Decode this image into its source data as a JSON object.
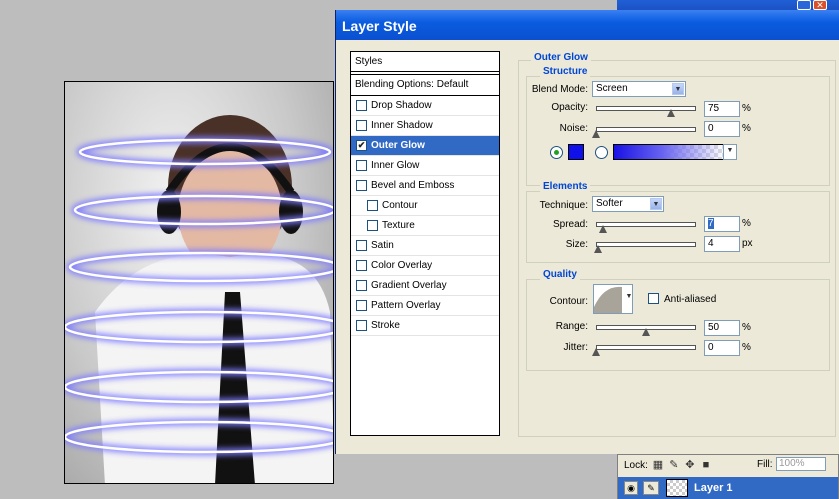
{
  "dialog": {
    "title": "Layer Style"
  },
  "styles_panel": {
    "header": "Styles",
    "blending_options": "Blending Options: Default",
    "items": [
      {
        "label": "Drop Shadow",
        "checked": false,
        "active": false,
        "indent": false
      },
      {
        "label": "Inner Shadow",
        "checked": false,
        "active": false,
        "indent": false
      },
      {
        "label": "Outer Glow",
        "checked": true,
        "active": true,
        "indent": false
      },
      {
        "label": "Inner Glow",
        "checked": false,
        "active": false,
        "indent": false
      },
      {
        "label": "Bevel and Emboss",
        "checked": false,
        "active": false,
        "indent": false
      },
      {
        "label": "Contour",
        "checked": false,
        "active": false,
        "indent": true
      },
      {
        "label": "Texture",
        "checked": false,
        "active": false,
        "indent": true
      },
      {
        "label": "Satin",
        "checked": false,
        "active": false,
        "indent": false
      },
      {
        "label": "Color Overlay",
        "checked": false,
        "active": false,
        "indent": false
      },
      {
        "label": "Gradient Overlay",
        "checked": false,
        "active": false,
        "indent": false
      },
      {
        "label": "Pattern Overlay",
        "checked": false,
        "active": false,
        "indent": false
      },
      {
        "label": "Stroke",
        "checked": false,
        "active": false,
        "indent": false
      }
    ]
  },
  "outer_glow": {
    "title": "Outer Glow",
    "structure": {
      "title": "Structure",
      "blend_mode_label": "Blend Mode:",
      "blend_mode_value": "Screen",
      "opacity_label": "Opacity:",
      "opacity_value": "75",
      "opacity_level": 0.75,
      "noise_label": "Noise:",
      "noise_value": "0",
      "noise_level": 0,
      "percent": "%",
      "glow_color": "#1010e8"
    },
    "elements": {
      "title": "Elements",
      "technique_label": "Technique:",
      "technique_value": "Softer",
      "spread_label": "Spread:",
      "spread_value": "7",
      "spread_level": 0.07,
      "size_label": "Size:",
      "size_value": "4",
      "size_level": 0.02,
      "percent": "%",
      "px": "px"
    },
    "quality": {
      "title": "Quality",
      "contour_label": "Contour:",
      "anti_aliased_label": "Anti-aliased",
      "range_label": "Range:",
      "range_value": "50",
      "range_level": 0.5,
      "jitter_label": "Jitter:",
      "jitter_value": "0",
      "jitter_level": 0,
      "percent": "%"
    }
  },
  "layers_panel": {
    "lock_label": "Lock:",
    "fill_label": "Fill:",
    "fill_value": "100%",
    "layer_name": "Layer 1"
  },
  "colors": {
    "title_bar": "#0a5ce0",
    "selection": "#316ac5",
    "dialog_bg": "#ece9d8"
  }
}
